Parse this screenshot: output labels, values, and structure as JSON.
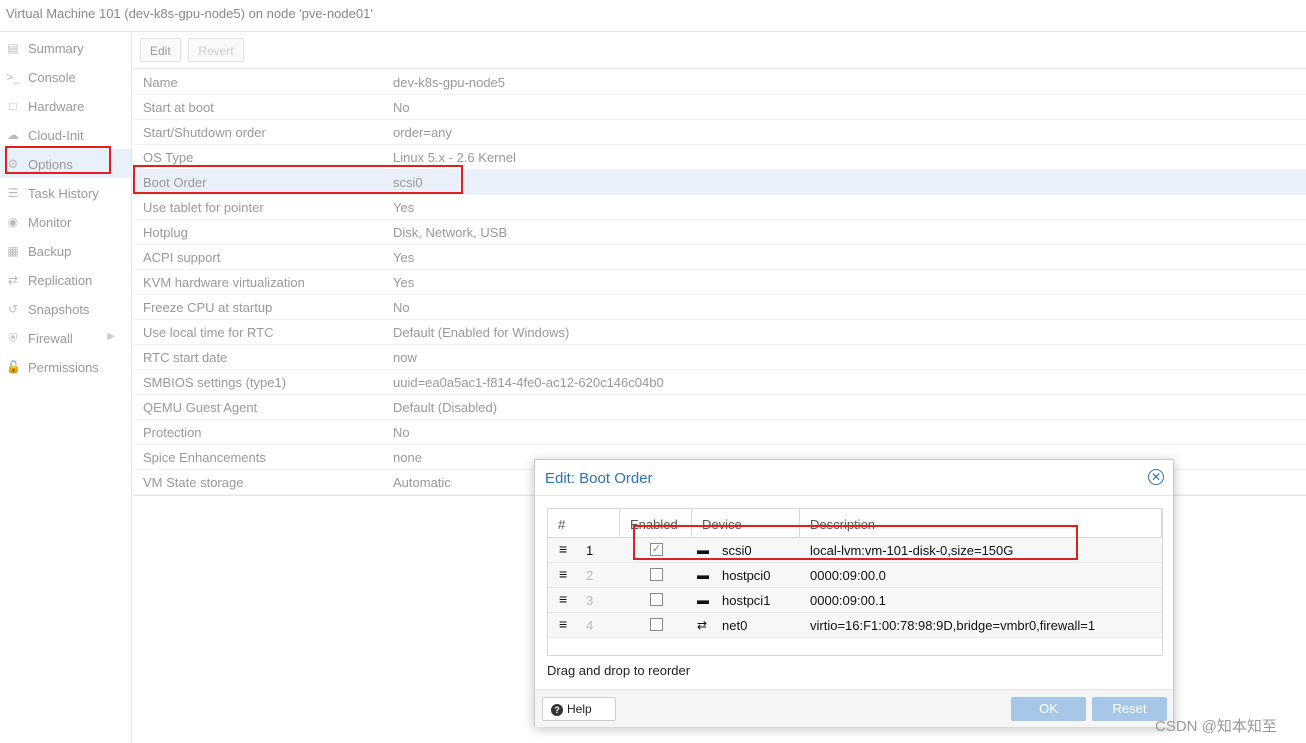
{
  "header": {
    "title": "Virtual Machine 101 (dev-k8s-gpu-node5) on node 'pve-node01'"
  },
  "sidebar": {
    "items": [
      {
        "label": "Summary",
        "icon": "book-icon"
      },
      {
        "label": "Console",
        "icon": "terminal-icon"
      },
      {
        "label": "Hardware",
        "icon": "monitor-icon"
      },
      {
        "label": "Cloud-Init",
        "icon": "cloud-icon"
      },
      {
        "label": "Options",
        "icon": "gear-icon"
      },
      {
        "label": "Task History",
        "icon": "list-icon"
      },
      {
        "label": "Monitor",
        "icon": "eye-icon"
      },
      {
        "label": "Backup",
        "icon": "floppy-icon"
      },
      {
        "label": "Replication",
        "icon": "retweet-icon"
      },
      {
        "label": "Snapshots",
        "icon": "history-icon"
      },
      {
        "label": "Firewall",
        "icon": "shield-icon"
      },
      {
        "label": "Permissions",
        "icon": "unlock-icon"
      }
    ]
  },
  "toolbar": {
    "edit_label": "Edit",
    "revert_label": "Revert"
  },
  "options": [
    {
      "key": "Name",
      "value": "dev-k8s-gpu-node5"
    },
    {
      "key": "Start at boot",
      "value": "No"
    },
    {
      "key": "Start/Shutdown order",
      "value": "order=any"
    },
    {
      "key": "OS Type",
      "value": "Linux 5.x - 2.6 Kernel"
    },
    {
      "key": "Boot Order",
      "value": "scsi0"
    },
    {
      "key": "Use tablet for pointer",
      "value": "Yes"
    },
    {
      "key": "Hotplug",
      "value": "Disk, Network, USB"
    },
    {
      "key": "ACPI support",
      "value": "Yes"
    },
    {
      "key": "KVM hardware virtualization",
      "value": "Yes"
    },
    {
      "key": "Freeze CPU at startup",
      "value": "No"
    },
    {
      "key": "Use local time for RTC",
      "value": "Default (Enabled for Windows)"
    },
    {
      "key": "RTC start date",
      "value": "now"
    },
    {
      "key": "SMBIOS settings (type1)",
      "value": "uuid=ea0a5ac1-f814-4fe0-ac12-620c146c04b0"
    },
    {
      "key": "QEMU Guest Agent",
      "value": "Default (Disabled)"
    },
    {
      "key": "Protection",
      "value": "No"
    },
    {
      "key": "Spice Enhancements",
      "value": "none"
    },
    {
      "key": "VM State storage",
      "value": "Automatic"
    }
  ],
  "dialog": {
    "title": "Edit: Boot Order",
    "columns": {
      "num": "#",
      "enabled": "Enabled",
      "device": "Device",
      "description": "Description"
    },
    "rows": [
      {
        "num": "1",
        "enabled": true,
        "device": "scsi0",
        "device_icon": "hdd-icon",
        "description": "local-lvm:vm-101-disk-0,size=150G"
      },
      {
        "num": "2",
        "enabled": false,
        "device": "hostpci0",
        "device_icon": "hdd-icon",
        "description": "0000:09:00.0"
      },
      {
        "num": "3",
        "enabled": false,
        "device": "hostpci1",
        "device_icon": "hdd-icon",
        "description": "0000:09:00.1"
      },
      {
        "num": "4",
        "enabled": false,
        "device": "net0",
        "device_icon": "exchange-icon",
        "description": "virtio=16:F1:00:78:98:9D,bridge=vmbr0,firewall=1"
      }
    ],
    "hint": "Drag and drop to reorder",
    "help_label": "Help",
    "ok_label": "OK",
    "reset_label": "Reset"
  },
  "watermark": "CSDN @知本知至",
  "colors": {
    "accent": "#2d72b6",
    "annotation_red": "#e0201f",
    "selected_row": "#e9f0fa",
    "primary_button": "#a7c7e8"
  }
}
